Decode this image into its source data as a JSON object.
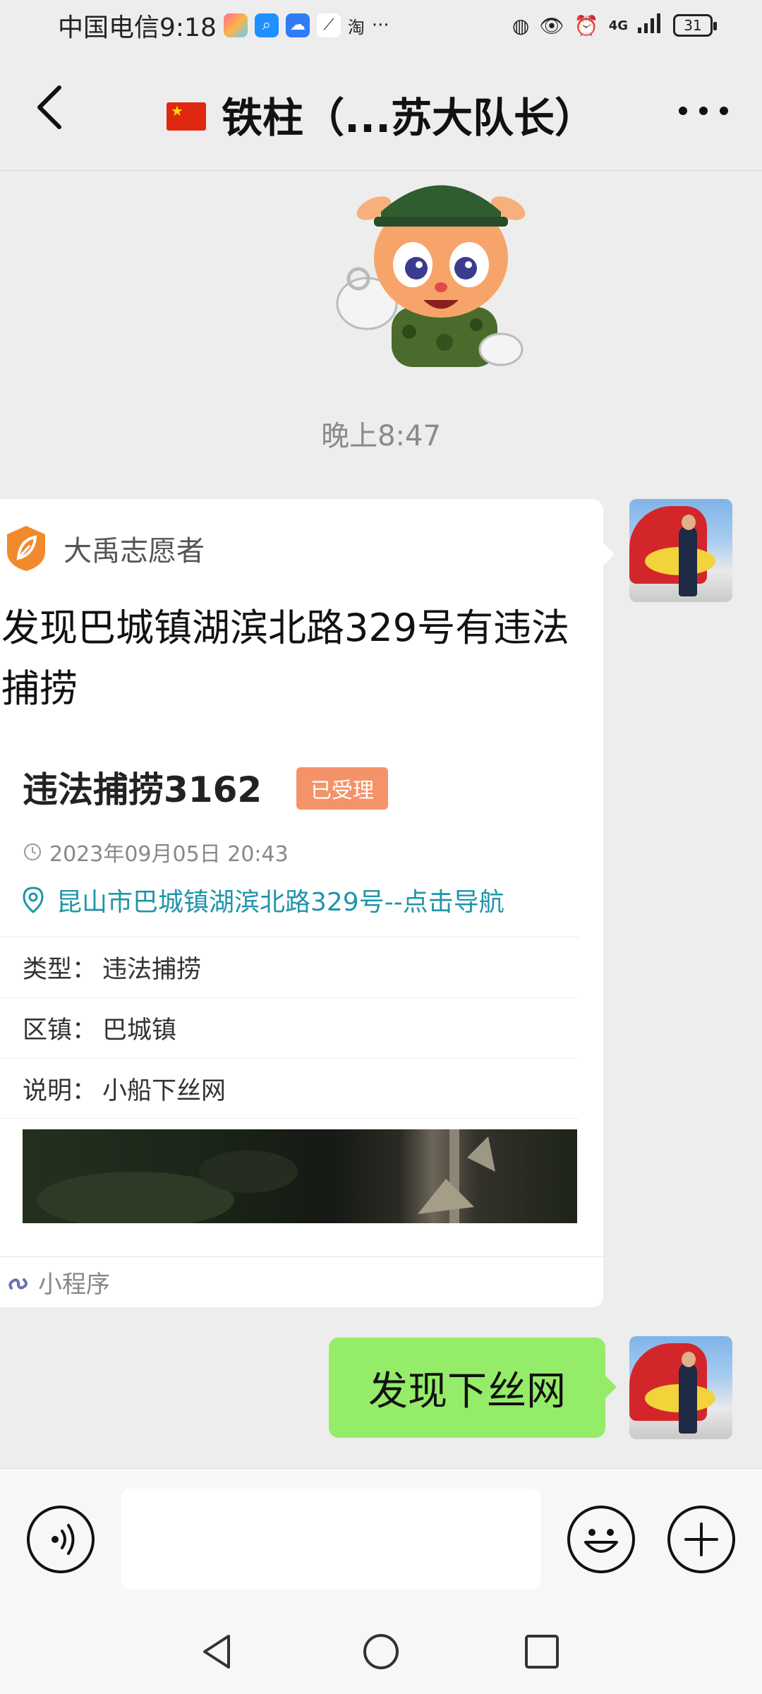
{
  "status_bar": {
    "carrier_time": "中国电信9:18",
    "taobao_icon_text": "淘",
    "more_dots": "···",
    "network": "4G",
    "battery": "31"
  },
  "header": {
    "title": "铁柱（...苏大队长）"
  },
  "chat": {
    "timestamp": "晚上8:47",
    "card": {
      "source": "大禹志愿者",
      "headline": "发现巴城镇湖滨北路329号有违法捕捞",
      "case_title": "违法捕捞3162",
      "status": "已受理",
      "datetime": "2023年09月05日 20:43",
      "location": "昆山市巴城镇湖滨北路329号--点击导航",
      "rows": [
        {
          "label": "类型：",
          "value": "违法捕捞"
        },
        {
          "label": "区镇：",
          "value": "巴城镇"
        },
        {
          "label": "说明：",
          "value": "小船下丝网"
        }
      ],
      "footer": "小程序"
    },
    "sent_message": "发现下丝网"
  },
  "colors": {
    "accent_green": "#95ec69",
    "badge_orange": "#f4936a",
    "link_teal": "#1f95a8"
  }
}
